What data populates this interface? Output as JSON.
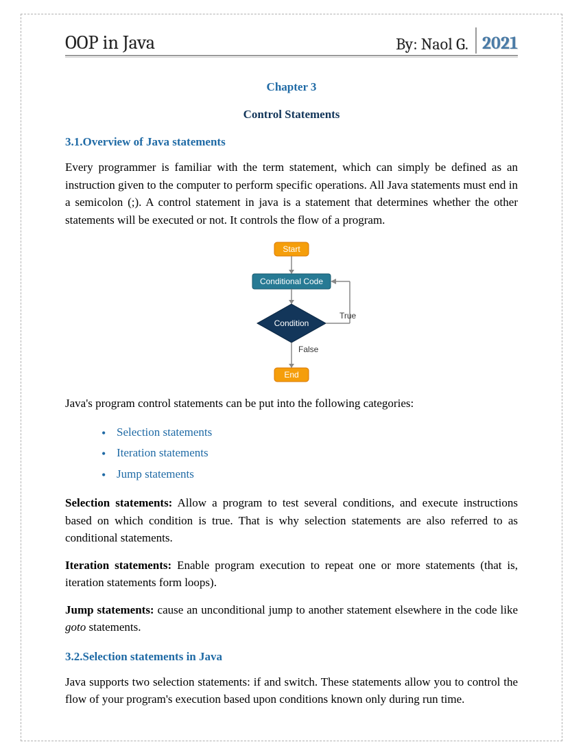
{
  "header": {
    "title": "OOP in Java",
    "author": "By: Naol G.",
    "year": "2021"
  },
  "chapter": {
    "label": "Chapter 3",
    "title": "Control Statements"
  },
  "section1": {
    "heading": "3.1.Overview of Java statements",
    "para1": "Every programmer is familiar with the term statement, which can simply be defined as an instruction given to the computer to perform specific operations. All Java statements must end in a semicolon (;). A control statement in java is a statement that determines whether the other statements will be executed or not. It controls the flow of a program.",
    "flowchart": {
      "start": "Start",
      "cond_code": "Conditional Code",
      "condition": "Condition",
      "true_label": "True",
      "false_label": "False",
      "end": "End"
    },
    "para2": "Java's program control statements can be put into the following categories:",
    "bullets": [
      "Selection statements",
      "Iteration statements",
      "Jump statements"
    ],
    "def1_term": "Selection statements:",
    "def1_body": " Allow a program to test several conditions, and execute instructions based on which condition is true. That is why selection statements are also referred to as conditional statements.",
    "def2_term": "Iteration statements:",
    "def2_body": " Enable program execution to repeat one or more statements (that is, iteration statements form loops).",
    "def3_term": "Jump statements:",
    "def3_body_a": " cause an unconditional jump to another statement elsewhere in the code like ",
    "def3_italic": "goto",
    "def3_body_b": " statements."
  },
  "section2": {
    "heading": "3.2.Selection statements in Java",
    "para1": "Java supports two selection statements: if and switch. These statements allow you to control the flow of your program's execution based upon conditions known only during run time."
  }
}
